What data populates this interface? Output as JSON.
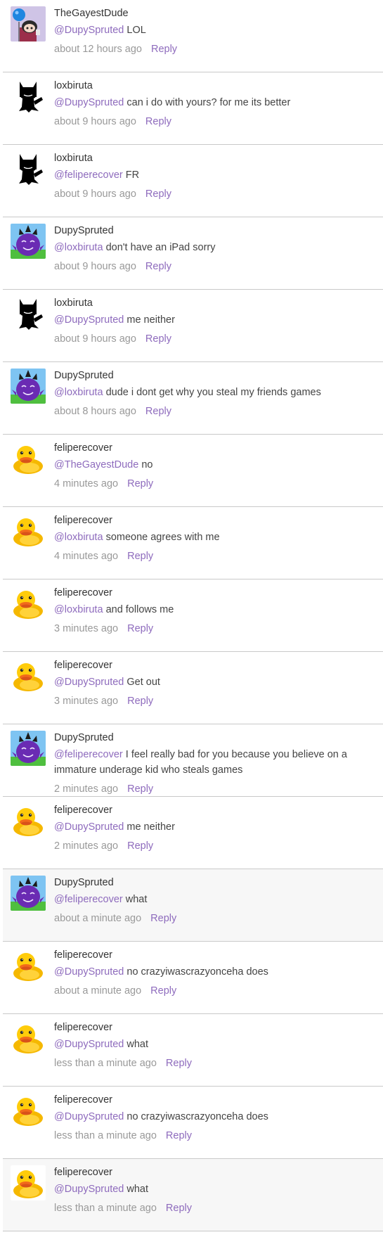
{
  "reply_label": "Reply",
  "colors": {
    "mention": "#8e6bbd",
    "meta": "#999999",
    "divider": "#c9c9c9",
    "highlight_bg": "#f7f7f7"
  },
  "comments": [
    {
      "user": "TheGayestDude",
      "avatar": "character-avatar",
      "mention": "@DupySpruted",
      "text": "LOL",
      "time": "about 12 hours ago",
      "highlight": false
    },
    {
      "user": "loxbiruta",
      "avatar": "black-cat-avatar",
      "mention": "@DupySpruted",
      "text": "can i do with yours? for me its better",
      "time": "about 9 hours ago",
      "highlight": false
    },
    {
      "user": "loxbiruta",
      "avatar": "black-cat-avatar",
      "mention": "@feliperecover",
      "text": "FR",
      "time": "about 9 hours ago",
      "highlight": false
    },
    {
      "user": "DupySpruted",
      "avatar": "purple-creature-avatar",
      "mention": "@loxbiruta",
      "text": "don't have an iPad sorry",
      "time": "about 9 hours ago",
      "highlight": false
    },
    {
      "user": "loxbiruta",
      "avatar": "black-cat-avatar",
      "mention": "@DupySpruted",
      "text": "me neither",
      "time": "about 9 hours ago",
      "highlight": false
    },
    {
      "user": "DupySpruted",
      "avatar": "purple-creature-avatar",
      "mention": "@loxbiruta",
      "text": "dude i dont get why you steal my friends games",
      "time": "about 8 hours ago",
      "highlight": false
    },
    {
      "user": "feliperecover",
      "avatar": "rubber-duck-avatar",
      "mention": "@TheGayestDude",
      "text": "no",
      "time": "4 minutes ago",
      "highlight": false
    },
    {
      "user": "feliperecover",
      "avatar": "rubber-duck-avatar",
      "mention": "@loxbiruta",
      "text": "someone agrees with me",
      "time": "4 minutes ago",
      "highlight": false
    },
    {
      "user": "feliperecover",
      "avatar": "rubber-duck-avatar",
      "mention": "@loxbiruta",
      "text": "and follows me",
      "time": "3 minutes ago",
      "highlight": false
    },
    {
      "user": "feliperecover",
      "avatar": "rubber-duck-avatar",
      "mention": "@DupySpruted",
      "text": "Get out",
      "time": "3 minutes ago",
      "highlight": false
    },
    {
      "user": "DupySpruted",
      "avatar": "purple-creature-avatar",
      "mention": "@feliperecover",
      "text": "I feel really bad for you because you believe on a immature underage kid who steals games",
      "time": "2 minutes ago",
      "highlight": false
    },
    {
      "user": "feliperecover",
      "avatar": "rubber-duck-avatar",
      "mention": "@DupySpruted",
      "text": "me neither",
      "time": "2 minutes ago",
      "highlight": false
    },
    {
      "user": "DupySpruted",
      "avatar": "purple-creature-avatar",
      "mention": "@feliperecover",
      "text": "what",
      "time": "about a minute ago",
      "highlight": true
    },
    {
      "user": "feliperecover",
      "avatar": "rubber-duck-avatar",
      "mention": "@DupySpruted",
      "text": "no crazyiwascrazyonceha does",
      "time": "about a minute ago",
      "highlight": false
    },
    {
      "user": "feliperecover",
      "avatar": "rubber-duck-avatar",
      "mention": "@DupySpruted",
      "text": "what",
      "time": "less than a minute ago",
      "highlight": false
    },
    {
      "user": "feliperecover",
      "avatar": "rubber-duck-avatar",
      "mention": "@DupySpruted",
      "text": "no crazyiwascrazyonceha does",
      "time": "less than a minute ago",
      "highlight": false
    },
    {
      "user": "feliperecover",
      "avatar": "rubber-duck-avatar",
      "mention": "@DupySpruted",
      "text": "what",
      "time": "less than a minute ago",
      "highlight": true
    }
  ]
}
